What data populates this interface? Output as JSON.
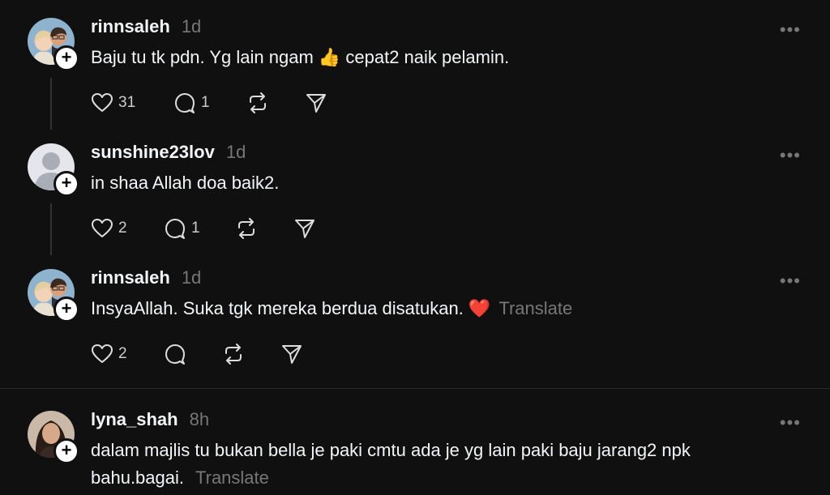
{
  "posts": [
    {
      "username": "rinnsaleh",
      "time": "1d",
      "text": "Baju tu tk pdn. Yg lain ngam 👍 cepat2 naik pelamin.",
      "translate": "",
      "likes": "31",
      "replies": "1"
    },
    {
      "username": "sunshine23lov",
      "time": "1d",
      "text": "in shaa Allah doa baik2.",
      "translate": "",
      "likes": "2",
      "replies": "1"
    },
    {
      "username": "rinnsaleh",
      "time": "1d",
      "text": "InsyaAllah. Suka tgk mereka berdua disatukan. ❤️",
      "translate": "Translate",
      "likes": "2",
      "replies": ""
    },
    {
      "username": "lyna_shah",
      "time": "8h",
      "text": "dalam majlis tu bukan bella je paki cmtu ada je yg lain paki baju jarang2 npk",
      "text2": "bahu.bagai.",
      "translate": "Translate"
    }
  ],
  "icons": {
    "more": "more-dots-icon",
    "like": "heart-icon",
    "reply": "comment-icon",
    "repost": "repost-icon",
    "share": "send-icon",
    "follow": "plus-icon"
  },
  "colors": {
    "background": "#101010",
    "text": "#f3f5f7",
    "muted": "#777777"
  }
}
